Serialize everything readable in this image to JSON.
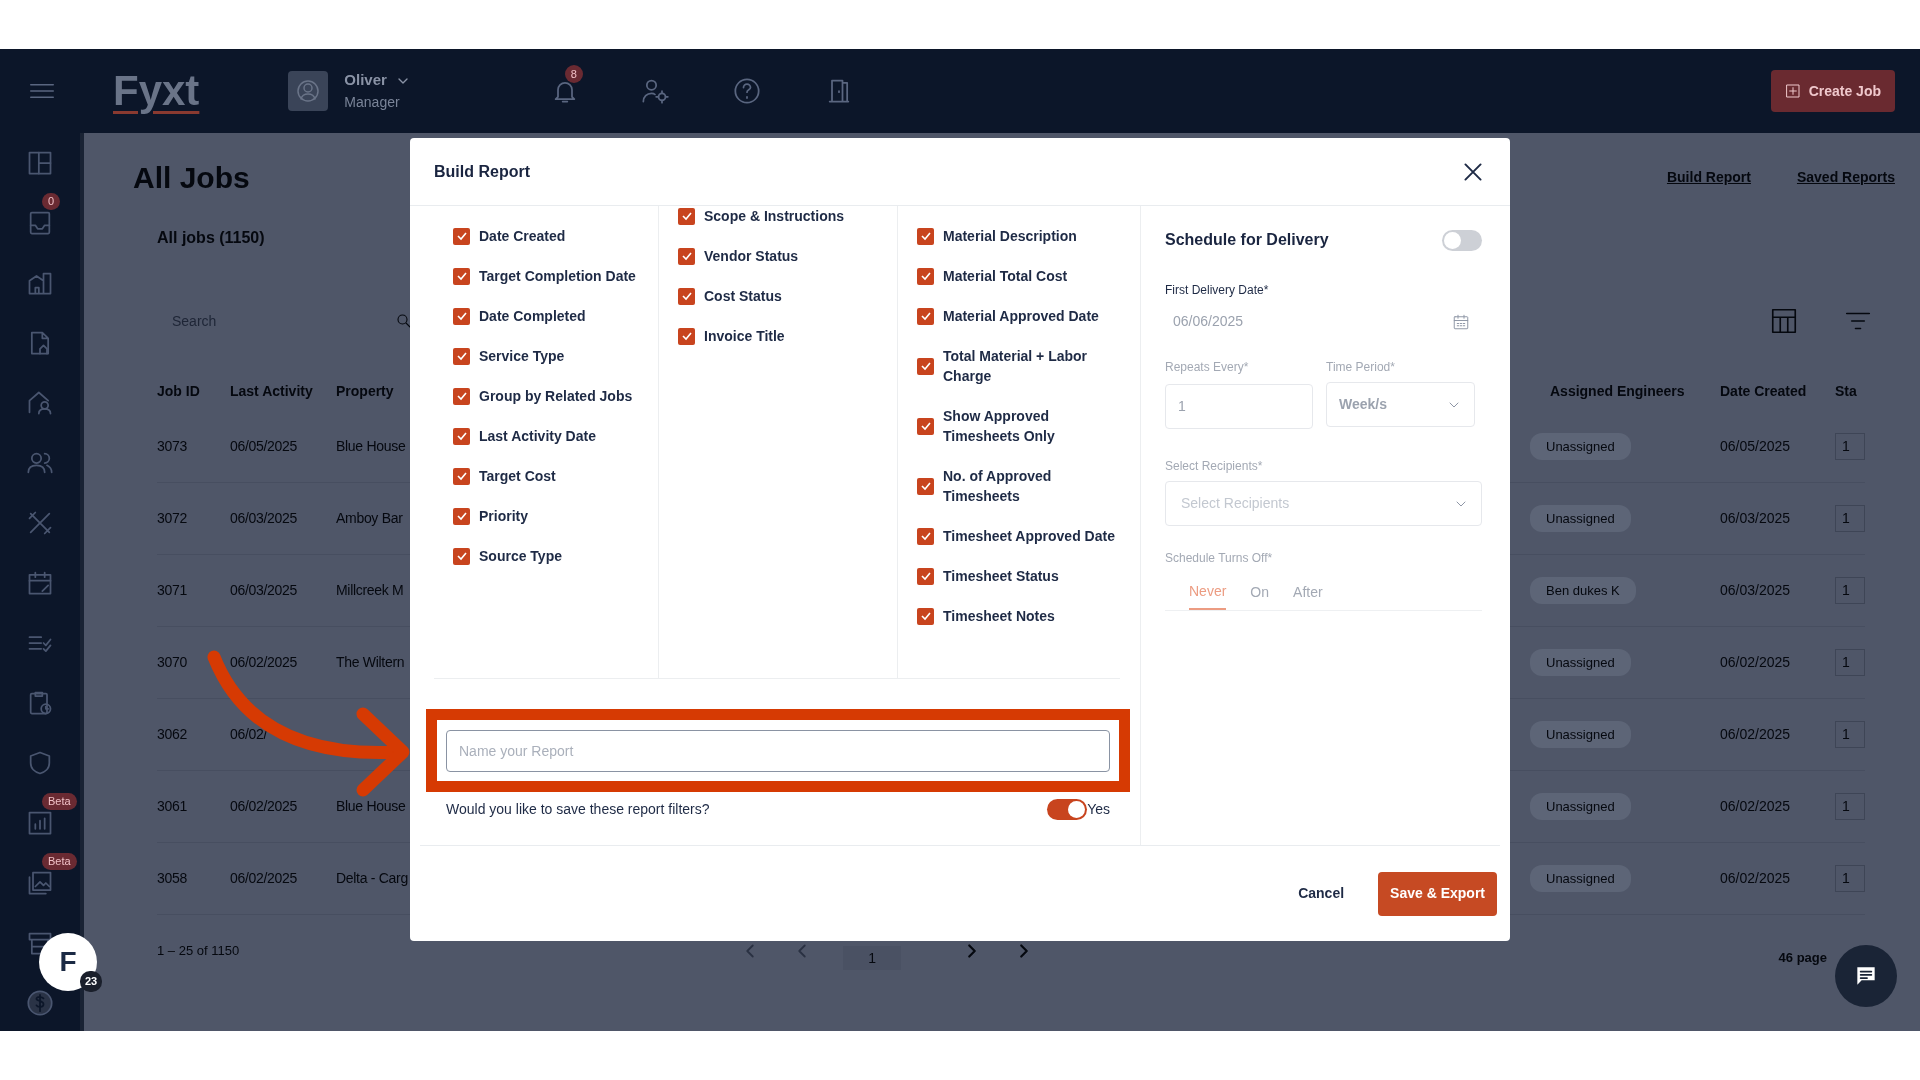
{
  "nav": {
    "logo": "Fyxt",
    "user_name": "Oliver",
    "user_role": "Manager",
    "notification_count": "8",
    "create_button": "Create Job"
  },
  "sidebar": {
    "items": [
      {
        "kind": "layout"
      },
      {
        "kind": "inbox",
        "badge": "0"
      },
      {
        "kind": "building"
      },
      {
        "kind": "file"
      },
      {
        "kind": "homeuser"
      },
      {
        "kind": "users"
      },
      {
        "kind": "tools"
      },
      {
        "kind": "calendar"
      },
      {
        "kind": "checklist"
      },
      {
        "kind": "clipclock"
      },
      {
        "kind": "shield"
      },
      {
        "kind": "chart",
        "badge": "Beta"
      },
      {
        "kind": "image",
        "badge": "Beta"
      },
      {
        "kind": "store"
      },
      {
        "kind": "dollar"
      }
    ]
  },
  "page": {
    "title": "All Jobs",
    "links": [
      "Build Report",
      "Saved Reports"
    ],
    "subtitle": "All jobs (1150)",
    "search": {
      "placeholder": "Search"
    }
  },
  "table": {
    "columns_left": [
      "Job ID",
      "Last Activity",
      "Property"
    ],
    "columns_right": [
      "Assigned Engineers",
      "Date Created",
      "Sta"
    ],
    "rows": [
      {
        "job_id": "3073",
        "last_activity": "06/05/2025",
        "property": "Blue House",
        "assigned_engineers": "Unassigned",
        "date_created": "06/05/2025",
        "column_6": "1"
      },
      {
        "job_id": "3072",
        "last_activity": "06/03/2025",
        "property": "Amboy Bar",
        "assigned_engineers": "Unassigned",
        "date_created": "06/03/2025",
        "column_6": "1"
      },
      {
        "job_id": "3071",
        "last_activity": "06/03/2025",
        "property": "Millcreek M",
        "assigned_engineers": "Ben dukes K",
        "date_created": "06/03/2025",
        "column_6": "1"
      },
      {
        "job_id": "3070",
        "last_activity": "06/02/2025",
        "property": "The Wiltern",
        "assigned_engineers": "Unassigned",
        "date_created": "06/02/2025",
        "column_6": "1"
      },
      {
        "job_id": "3062",
        "last_activity": "06/02/",
        "assigned_engineers": "Unassigned",
        "date_created": "06/02/2025",
        "column_6": "1"
      },
      {
        "job_id": "3061",
        "last_activity": "06/02/2025",
        "property": "Blue House",
        "assigned_engineers": "Unassigned",
        "date_created": "06/02/2025",
        "column_6": "1"
      },
      {
        "job_id": "3058",
        "last_activity": "06/02/2025",
        "property": "Delta - Carg",
        "assigned_engineers": "Unassigned",
        "date_created": "06/02/2025",
        "column_6": "1"
      }
    ]
  },
  "pagination": {
    "range": "1 – 25 of 1150",
    "page": "1",
    "pages": "46 page"
  },
  "floating_avatar": {
    "letter": "F",
    "count": "23"
  },
  "modal": {
    "title": "Build Report",
    "columns": [
      {
        "items": [
          {
            "label": "Date Created",
            "checked": true
          },
          {
            "label": "Target Completion Date",
            "checked": true
          },
          {
            "label": "Date Completed",
            "checked": true
          },
          {
            "label": "Service Type",
            "checked": true
          },
          {
            "label": "Group by Related Jobs",
            "checked": true
          },
          {
            "label": "Last Activity Date",
            "checked": true
          },
          {
            "label": "Target Cost",
            "checked": true
          },
          {
            "label": "Priority",
            "checked": true
          },
          {
            "label": "Source Type",
            "checked": true
          }
        ]
      },
      {
        "items": [
          {
            "label": "Scope & Instructions",
            "checked": true
          },
          {
            "label": "Vendor Status",
            "checked": true
          },
          {
            "label": "Cost Status",
            "checked": true
          },
          {
            "label": "Invoice Title",
            "checked": true
          }
        ]
      },
      {
        "items": [
          {
            "label": "Material Description",
            "checked": true
          },
          {
            "label": "Material Total Cost",
            "checked": true
          },
          {
            "label": "Material Approved Date",
            "checked": true
          },
          {
            "label": "Total Material + Labor Charge",
            "checked": true
          },
          {
            "label": "Show Approved Timesheets Only",
            "checked": true
          },
          {
            "label": "No. of Approved Timesheets",
            "checked": true
          },
          {
            "label": "Timesheet Approved Date",
            "checked": true
          },
          {
            "label": "Timesheet Status",
            "checked": true
          },
          {
            "label": "Timesheet Notes",
            "checked": true
          }
        ]
      }
    ],
    "name_field": {
      "placeholder": "Name your Report"
    },
    "save_filters": {
      "question": "Would you like to save these report filters?",
      "on": true,
      "toggle_label": "Yes"
    },
    "schedule": {
      "title": "Schedule for Delivery",
      "on": false,
      "first_date": {
        "label": "First Delivery Date*",
        "value": "06/06/2025"
      },
      "repeats": {
        "label": "Repeats Every*",
        "value": "1"
      },
      "period": {
        "label": "Time Period*",
        "value": "Week/s"
      },
      "recipients": {
        "label": "Select Recipients*",
        "placeholder": "Select Recipients"
      },
      "turns_off": {
        "label": "Schedule Turns Off*",
        "tabs": [
          {
            "label": "Never",
            "selected": true
          },
          {
            "label": "On",
            "selected": false
          },
          {
            "label": "After",
            "selected": false
          }
        ]
      }
    },
    "buttons": [
      {
        "kind": "cancel",
        "label": "Cancel"
      },
      {
        "kind": "primary",
        "label": "Save & Export"
      }
    ]
  }
}
